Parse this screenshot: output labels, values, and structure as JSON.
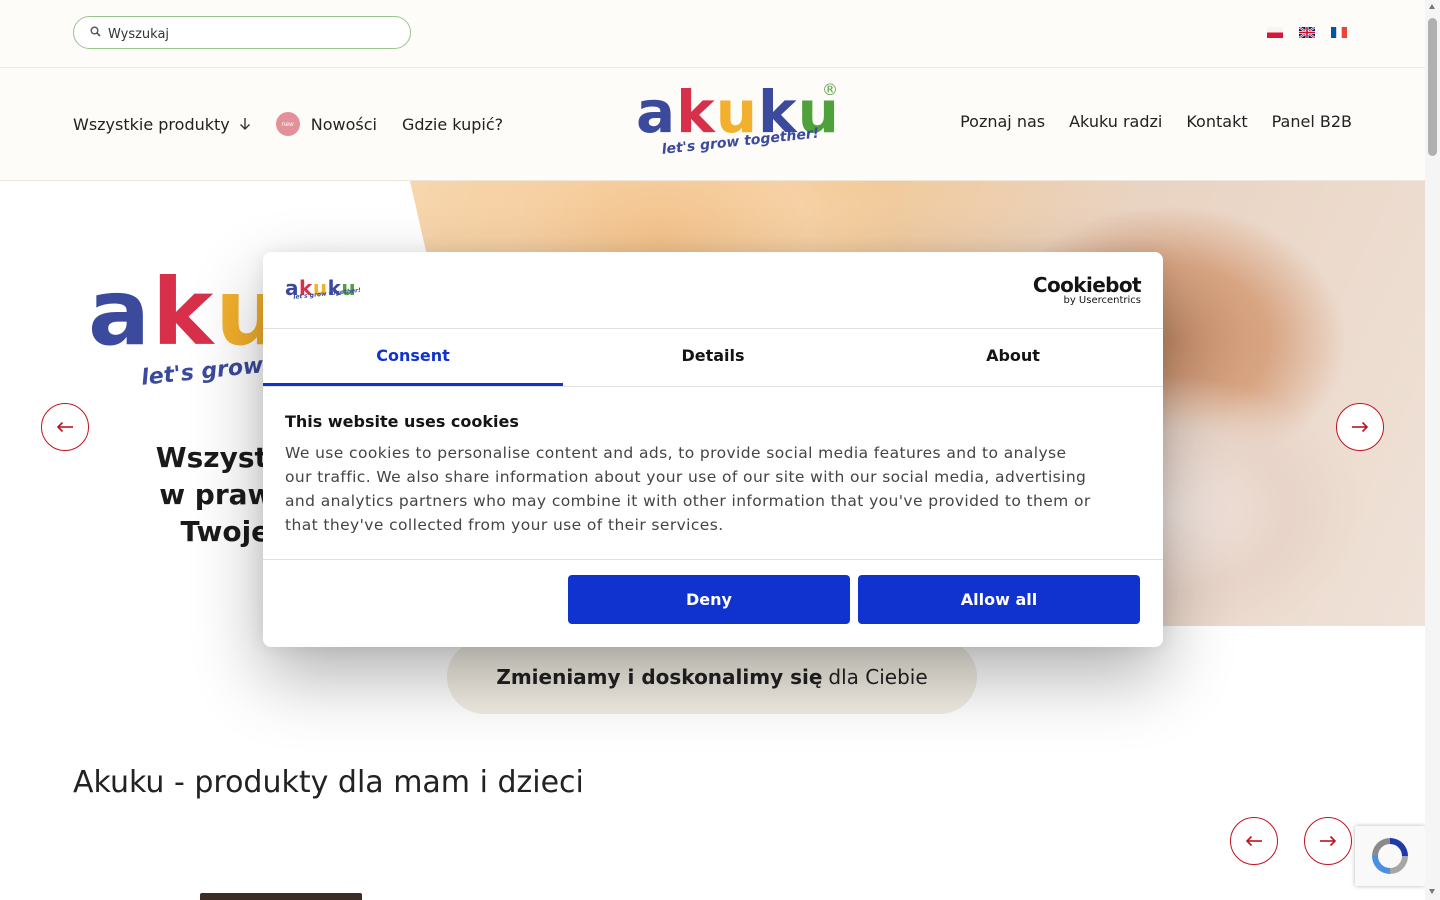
{
  "topbar": {
    "search_placeholder": "Wyszukaj",
    "languages": [
      "pl",
      "en",
      "fr"
    ]
  },
  "nav": {
    "left": {
      "all_products": "Wszystkie produkty",
      "new_badge": "new",
      "news": "Nowości",
      "where_to_buy": "Gdzie kupić?"
    },
    "right": [
      "Poznaj nas",
      "Akuku radzi",
      "Kontakt",
      "Panel B2B"
    ]
  },
  "logo": {
    "letters": [
      "a",
      "k",
      "u",
      "k",
      "u"
    ],
    "tagline": "let's grow together!",
    "registered": "®"
  },
  "hero": {
    "logo_letters": [
      "a",
      "k",
      "u"
    ],
    "tagline": "let's grow t",
    "text_lines": [
      "Wszystko co n",
      "w prawidłowy",
      "Twojego dz"
    ]
  },
  "pill": {
    "bold": "Zmieniamy i doskonalimy się",
    "normal": "dla Ciebie"
  },
  "section_title": "Akuku - produkty dla mam i dzieci",
  "cookie": {
    "brand_main": "Cookiebot",
    "brand_sub": "by Usercentrics",
    "tabs": [
      "Consent",
      "Details",
      "About"
    ],
    "title": "This website uses cookies",
    "body": "We use cookies to personalise content and ads, to provide social media features and to analyse our traffic. We also share information about your use of our site with our social media, advertising and analytics partners who may combine it with other information that you've provided to them or that they've collected from your use of their services.",
    "deny": "Deny",
    "allow": "Allow all"
  },
  "colors": {
    "accent_blue": "#1032cf",
    "arrow_red": "#c1121f",
    "logo_blue": "#3b4a9c",
    "logo_red": "#d8304a",
    "logo_yellow": "#f2b02c",
    "logo_green": "#4fa13c"
  }
}
